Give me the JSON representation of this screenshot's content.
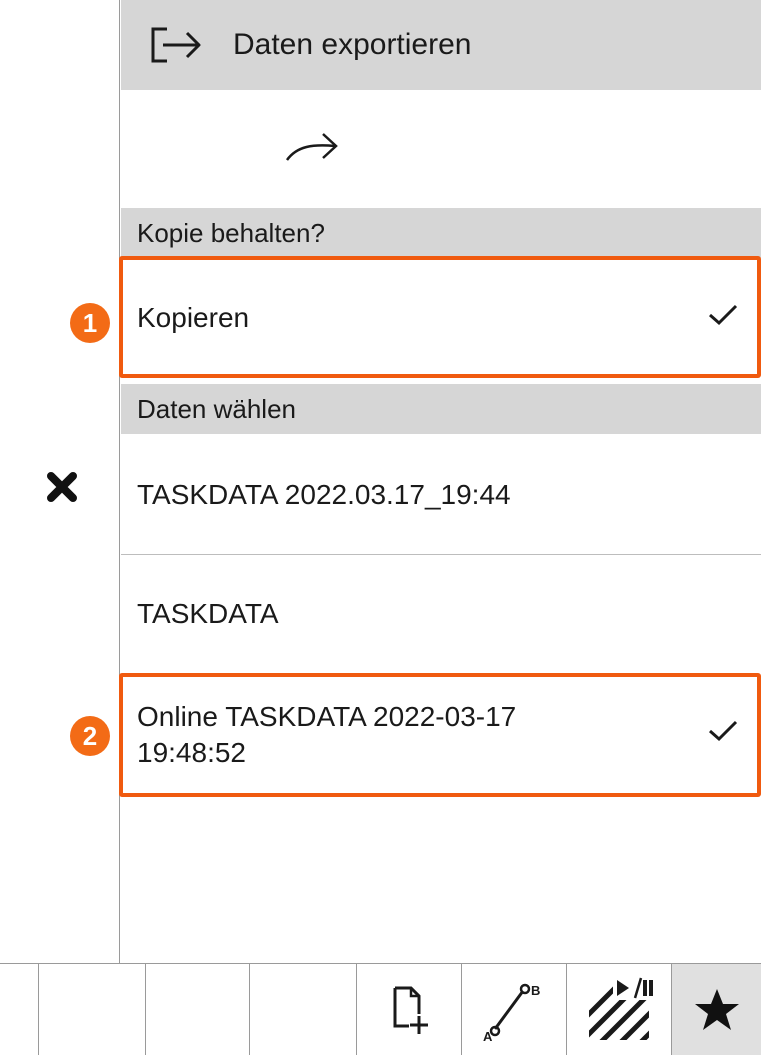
{
  "header": {
    "title": "Daten exportieren",
    "icon": "export-icon"
  },
  "direction_icon": "arrow-right-icon",
  "sections": {
    "keep_copy": {
      "title": "Kopie behalten?"
    },
    "select_data": {
      "title": "Daten wählen"
    }
  },
  "keep_copy_option": {
    "label": "Kopieren",
    "checked": true
  },
  "data_items": [
    {
      "line1": "TASKDATA 2022.03.17_19:44",
      "line2": "",
      "checked": false
    },
    {
      "line1": "TASKDATA",
      "line2": "",
      "checked": false
    },
    {
      "line1": "Online TASKDATA 2022-03-17",
      "line2": "19:48:52",
      "checked": true
    }
  ],
  "callouts": [
    "1",
    "2"
  ],
  "colors": {
    "accent": "#f05a0f",
    "badge": "#f36b16",
    "section_bg": "#d6d6d6"
  },
  "toolbar": {
    "buttons": [
      {
        "icon": ""
      },
      {
        "icon": ""
      },
      {
        "icon": ""
      },
      {
        "icon": "new-document-icon"
      },
      {
        "icon": "ab-line-icon",
        "label_a": "A",
        "label_b": "B"
      },
      {
        "icon": "section-control-play-pause-icon"
      },
      {
        "icon": "star-icon"
      }
    ]
  }
}
